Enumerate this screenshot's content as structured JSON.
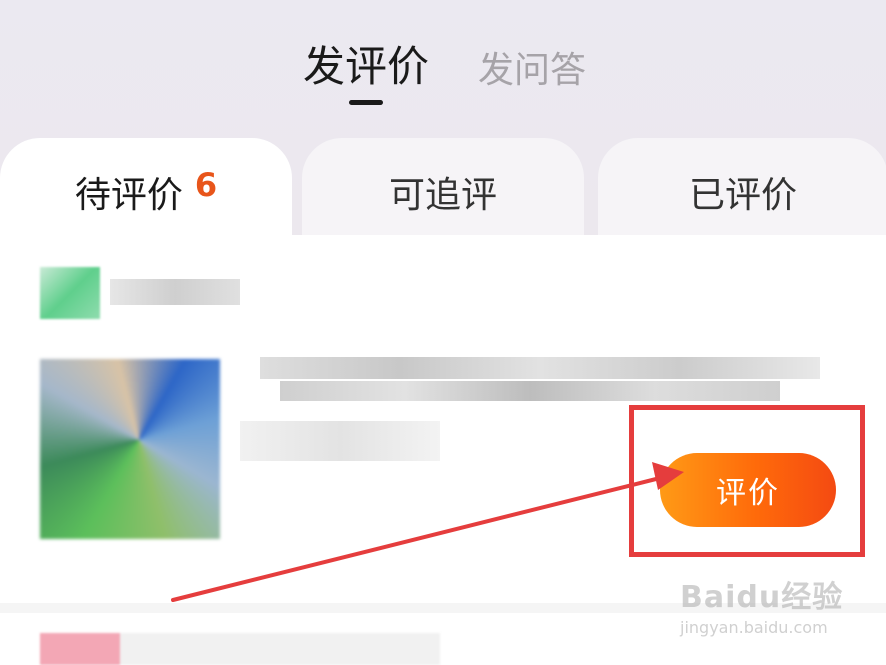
{
  "header": {
    "tabs": [
      {
        "label": "发评价",
        "active": true
      },
      {
        "label": "发问答",
        "active": false
      }
    ]
  },
  "subtabs": [
    {
      "label": "待评价",
      "count": "6",
      "active": true
    },
    {
      "label": "可追评",
      "active": false
    },
    {
      "label": "已评价",
      "active": false
    }
  ],
  "item": {
    "review_button_label": "评价"
  },
  "watermark": {
    "brand": "Baidu经验",
    "url": "jingyan.baidu.com"
  },
  "colors": {
    "accent": "#ff6a0a",
    "count": "#e8551a",
    "annotation": "#e53d3d"
  }
}
